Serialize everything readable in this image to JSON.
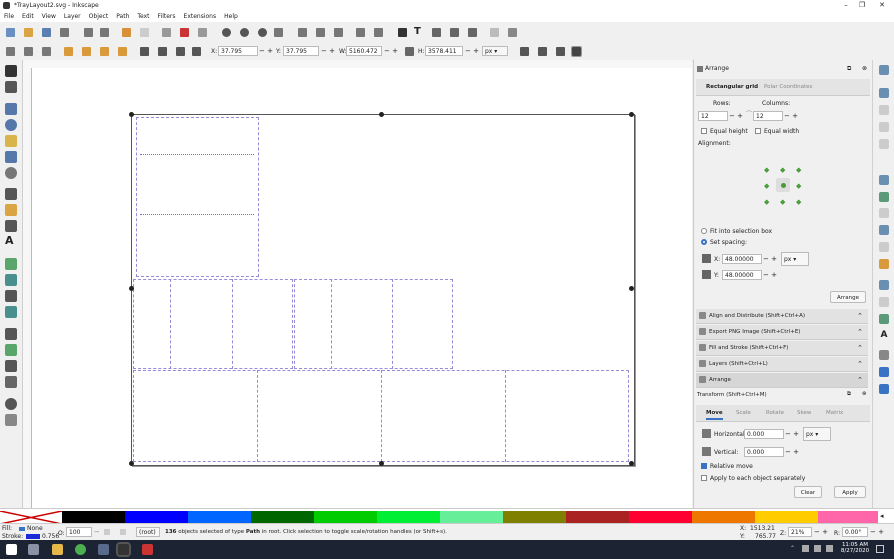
{
  "window": {
    "title": "*TrayLayout2.svg - Inkscape",
    "controls": [
      "–",
      "❐",
      "✕"
    ]
  },
  "menu": [
    "File",
    "Edit",
    "View",
    "Layer",
    "Object",
    "Path",
    "Text",
    "Filters",
    "Extensions",
    "Help"
  ],
  "toolcontrols": {
    "x_label": "X:",
    "x_value": "37.795",
    "y_label": "Y:",
    "y_value": "37.795",
    "w_label": "W:",
    "w_value": "5160.472",
    "h_label": "H:",
    "h_value": "3578.411",
    "unit": "px"
  },
  "arrange": {
    "panel_title": "Arrange",
    "tabs": [
      "Rectangular grid",
      "Polar Coordinates"
    ],
    "rows_label": "Rows:",
    "rows_value": "12",
    "columns_label": "Columns:",
    "columns_value": "12",
    "equal_height": "Equal height",
    "equal_width": "Equal width",
    "alignment_label": "Alignment:",
    "fit_selection": "Fit into selection box",
    "set_spacing": "Set spacing:",
    "spacing_x_label": "X:",
    "spacing_x": "48.00000",
    "spacing_y_label": "Y:",
    "spacing_y": "48.00000",
    "spacing_unit": "px",
    "arrange_button": "Arrange"
  },
  "docked_panels": [
    {
      "label": "Align and Distribute (Shift+Ctrl+A)"
    },
    {
      "label": "Export PNG Image (Shift+Ctrl+E)"
    },
    {
      "label": "Fill and Stroke (Shift+Ctrl+F)"
    },
    {
      "label": "Layers (Shift+Ctrl+L)"
    },
    {
      "label": "Arrange"
    }
  ],
  "transform": {
    "title": "Transform (Shift+Ctrl+M)",
    "tabs": [
      "Move",
      "Scale",
      "Rotate",
      "Skew",
      "Matrix"
    ],
    "horizontal_label": "Horizontal:",
    "horizontal_value": "0.000",
    "vertical_label": "Vertical:",
    "vertical_value": "0.000",
    "unit": "px",
    "relative_move": "Relative move",
    "apply_each": "Apply to each object separately",
    "clear_button": "Clear",
    "apply_button": "Apply"
  },
  "palette_colors": [
    "#000000",
    "#0000ff",
    "#0066ff",
    "#006600",
    "#00cc00",
    "#00ee33",
    "#66ee99",
    "#808000",
    "#aa2222",
    "#ff0033",
    "#ee7700",
    "#ffcc00",
    "#ff66aa"
  ],
  "status": {
    "fill_label": "Fill:",
    "fill_value": "None",
    "stroke_label": "Stroke:",
    "stroke_value": "0.756",
    "opacity_label": "O:",
    "opacity_value": "100",
    "layer": "(root)",
    "message_count": "136",
    "message_pre": " objects selected of type ",
    "message_type": "Path",
    "message_post": " in root. Click selection to toggle scale/rotation handles (or Shift+s).",
    "cursor_x_label": "X:",
    "cursor_x": "1513.21",
    "cursor_y_label": "Y:",
    "cursor_y": "765.77",
    "zoom_label": "Z:",
    "zoom_value": "21%",
    "rotate_label": "R:",
    "rotate_value": "0.00°"
  },
  "taskbar": {
    "time": "11:05 AM",
    "date": "8/27/2020"
  }
}
